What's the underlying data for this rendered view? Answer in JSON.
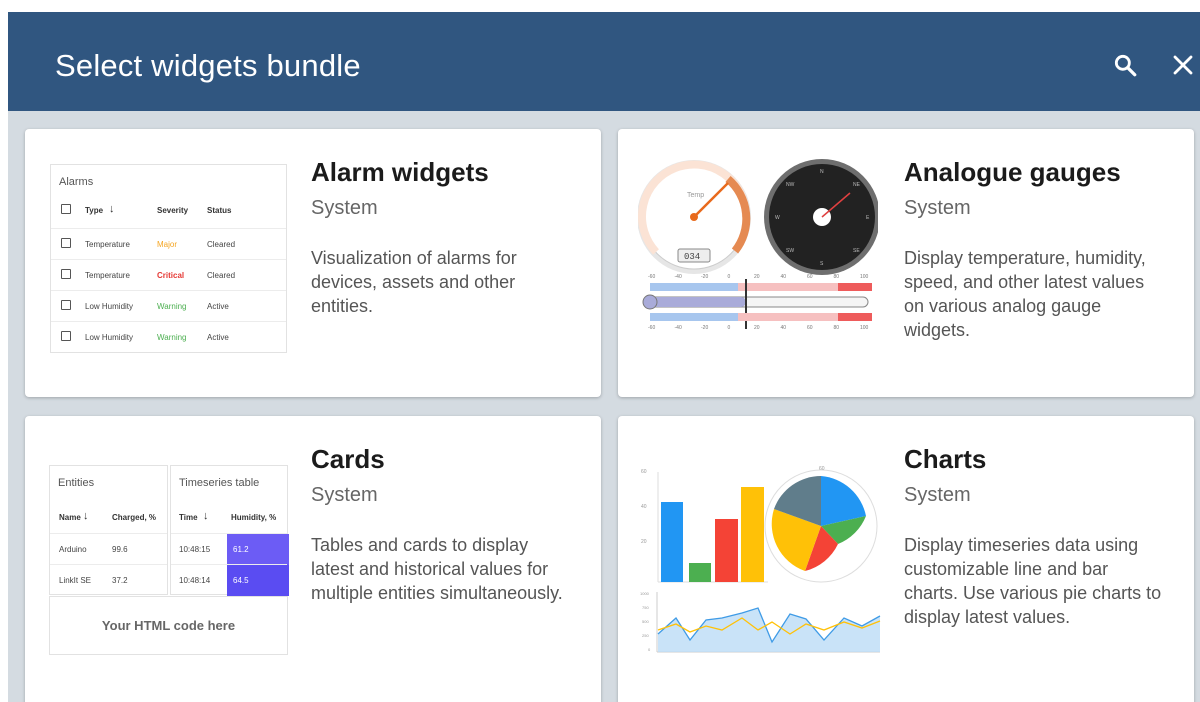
{
  "dialog": {
    "title": "Select widgets bundle"
  },
  "icons": {
    "search": "search-icon",
    "close": "close-icon"
  },
  "colors": {
    "header": "#305680",
    "backdrop": "#d4dbe1",
    "major": "#f5a623",
    "critical": "#e53935",
    "warning": "#4caf50",
    "highlight": "#6c5cf5"
  },
  "bundles": [
    {
      "title": "Alarm widgets",
      "subtitle": "System",
      "description": "Visualization of alarms for devices, assets and other entities.",
      "preview": {
        "title": "Alarms",
        "columns": [
          "Type",
          "Severity",
          "Status"
        ],
        "rows": [
          {
            "type": "Temperature",
            "severity": "Major",
            "status": "Cleared"
          },
          {
            "type": "Temperature",
            "severity": "Critical",
            "status": "Cleared"
          },
          {
            "type": "Low Humidity",
            "severity": "Warning",
            "status": "Active"
          },
          {
            "type": "Low Humidity",
            "severity": "Warning",
            "status": "Active"
          }
        ]
      }
    },
    {
      "title": "Analogue gauges",
      "subtitle": "System",
      "description": "Display temperature, humidity, speed, and other latest values on various analog gauge widgets.",
      "preview": {
        "gauge_label": "Temp",
        "gauge_readout": "034",
        "compass_labels": [
          "N",
          "NE",
          "E",
          "SE",
          "S",
          "SW",
          "W",
          "NW"
        ],
        "scale_ticks": [
          "-60",
          "-40",
          "-20",
          "0",
          "20",
          "40",
          "60",
          "80",
          "100"
        ]
      }
    },
    {
      "title": "Cards",
      "subtitle": "System",
      "description": "Tables and cards to display latest and historical values for multiple entities simultaneously.",
      "preview": {
        "entities_title": "Entities",
        "entities_columns": [
          "Name",
          "Charged, %"
        ],
        "entities_rows": [
          {
            "name": "Arduino",
            "charged": "99.6"
          },
          {
            "name": "LinkIt SE",
            "charged": "37.2"
          }
        ],
        "timeseries_title": "Timeseries table",
        "timeseries_columns": [
          "Time",
          "Humidity, %"
        ],
        "timeseries_rows": [
          {
            "time": "10:48:15",
            "humidity": "61.2"
          },
          {
            "time": "10:48:14",
            "humidity": "64.5"
          }
        ],
        "html_card_text": "Your HTML code here"
      }
    },
    {
      "title": "Charts",
      "subtitle": "System",
      "description": "Display timeseries data using customizable line and bar charts. Use various pie charts to display latest values.",
      "preview": {
        "bar_axis": [
          "60",
          "40",
          "20"
        ],
        "pie_top_label": "60",
        "line_axis": [
          "1000",
          "750",
          "500",
          "250",
          "0"
        ]
      }
    }
  ]
}
